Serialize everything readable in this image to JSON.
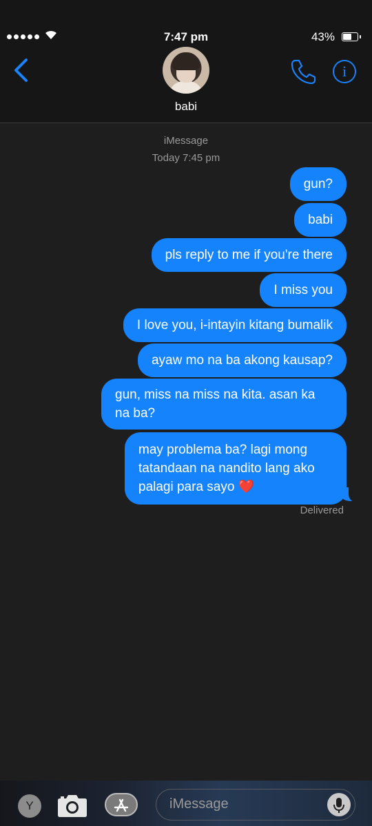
{
  "status_bar": {
    "time": "7:47 pm",
    "battery_percent": "43%",
    "signal_dots": 5,
    "battery_level": 0.43
  },
  "header": {
    "contact_name": "babi",
    "icons": [
      "back-chevron-icon",
      "avatar",
      "phone-icon",
      "info-icon"
    ],
    "info_glyph": "i"
  },
  "thread": {
    "service": "iMessage",
    "timestamp": "Today 7:45 pm",
    "messages": [
      {
        "text": "gun?",
        "from": "me"
      },
      {
        "text": "babi",
        "from": "me"
      },
      {
        "text": "pls reply to me if you're there",
        "from": "me"
      },
      {
        "text": "I miss you",
        "from": "me"
      },
      {
        "text": "I love you, i-intayin kitang bumalik",
        "from": "me"
      },
      {
        "text": "ayaw mo na ba akong kausap?",
        "from": "me"
      },
      {
        "text": "gun, miss na miss na kita. asan ka na ba?",
        "from": "me"
      },
      {
        "text": "may problema ba? lagi mong tatandaan na nandito lang ako palagi para sayo ❤️",
        "from": "me"
      }
    ],
    "status": "Delivered"
  },
  "composer": {
    "app_button_label": "Y",
    "placeholder": "iMessage",
    "icons": [
      "camera-icon",
      "app-store-icon",
      "microphone-icon"
    ]
  },
  "colors": {
    "bubble": "#1583fb",
    "accent": "#1a82fb",
    "background": "#1e1e1e"
  }
}
